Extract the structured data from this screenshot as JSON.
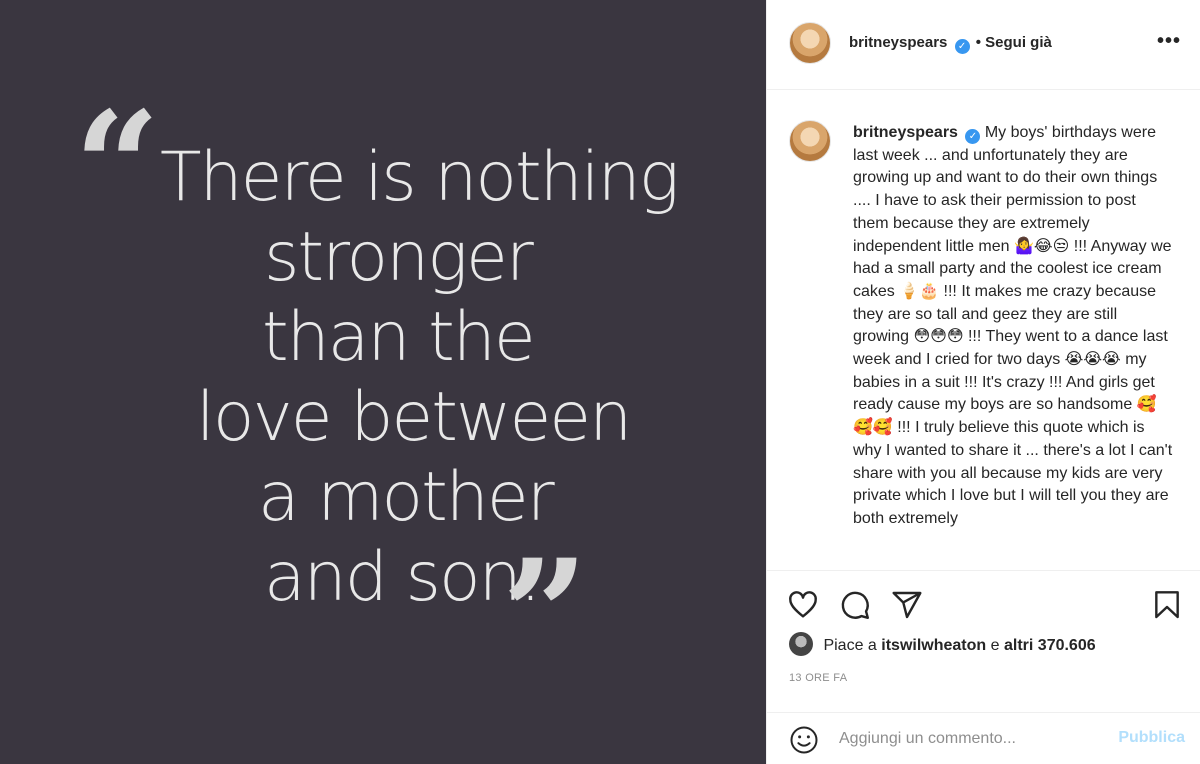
{
  "post_image": {
    "open_quote": "“",
    "close_quote": "”",
    "lines": [
      "There is nothing",
      "stronger",
      "than the",
      "love between",
      "a mother",
      "and son."
    ]
  },
  "header": {
    "username": "britneyspears",
    "follow_state": "• Segui già",
    "more_icon": "•••"
  },
  "caption": {
    "username": "britneyspears",
    "text": "My boys' birthdays were last week ... and unfortunately they are growing up and want to do their own things .... I have to ask their permission to post them because they are extremely independent little men 🤷‍♀️😂😒 !!! Anyway we had a small party and the coolest ice cream cakes 🍦🎂 !!! It makes me crazy because they are so tall and geez they are still growing 😳😳😳 !!! They went to a dance last week and I cried for two days 😭😭😭 my babies in a suit !!! It's crazy !!! And girls get ready cause my boys are so handsome 🥰🥰🥰 !!! I truly believe this quote which is why I wanted to share it ... there's a lot I can't share with you all because my kids are very private which I love but I will tell you they are both extremely"
  },
  "likes": {
    "prefix": "Piace a",
    "user": "itswilwheaton",
    "suffix": "e",
    "others": "altri 370.606"
  },
  "time": "13 ORE FA",
  "comment": {
    "placeholder": "Aggiungi un commento...",
    "publish_label": "Pubblica"
  },
  "icons": [
    "heart-icon",
    "comment-icon",
    "share-icon",
    "bookmark-icon",
    "emoji-icon",
    "verified-icon",
    "more-icon"
  ],
  "colors": {
    "image_background": "#3a3640",
    "quote_text": "#e8e8e8",
    "verified": "#3897f0",
    "publish_disabled": "#b2dffc"
  }
}
